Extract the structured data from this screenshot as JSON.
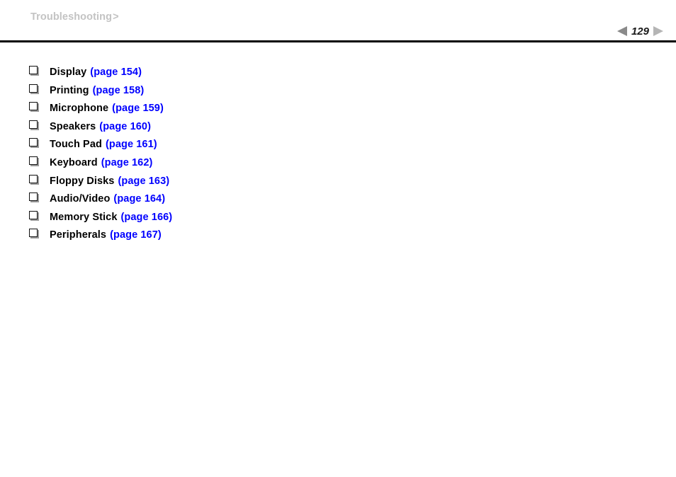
{
  "header": {
    "breadcrumb_label": "Troubleshooting",
    "breadcrumb_separator": ">",
    "breadcrumb_color": "#c3c3c3"
  },
  "page_nav": {
    "prev_icon": "triangle-left-icon",
    "next_icon": "triangle-right-icon",
    "page_number": "129",
    "prev_color": "#8a8a8a",
    "next_color": "#b5b5b5"
  },
  "link_color": "#0000ff",
  "topics": [
    {
      "bullet": "checkbox-bullet-icon",
      "label": "Display",
      "link": "(page 154)"
    },
    {
      "bullet": "checkbox-bullet-icon",
      "label": "Printing",
      "link": "(page 158)"
    },
    {
      "bullet": "checkbox-bullet-icon",
      "label": "Microphone",
      "link": "(page 159)"
    },
    {
      "bullet": "checkbox-bullet-icon",
      "label": "Speakers",
      "link": "(page 160)"
    },
    {
      "bullet": "checkbox-bullet-icon",
      "label": "Touch Pad",
      "link": "(page 161)"
    },
    {
      "bullet": "checkbox-bullet-icon",
      "label": "Keyboard",
      "link": "(page 162)"
    },
    {
      "bullet": "checkbox-bullet-icon",
      "label": "Floppy Disks",
      "link": "(page 163)"
    },
    {
      "bullet": "checkbox-bullet-icon",
      "label": "Audio/Video",
      "link": "(page 164)"
    },
    {
      "bullet": "checkbox-bullet-icon",
      "label": "Memory Stick",
      "link": "(page 166)"
    },
    {
      "bullet": "checkbox-bullet-icon",
      "label": "Peripherals",
      "link": "(page 167)"
    }
  ]
}
